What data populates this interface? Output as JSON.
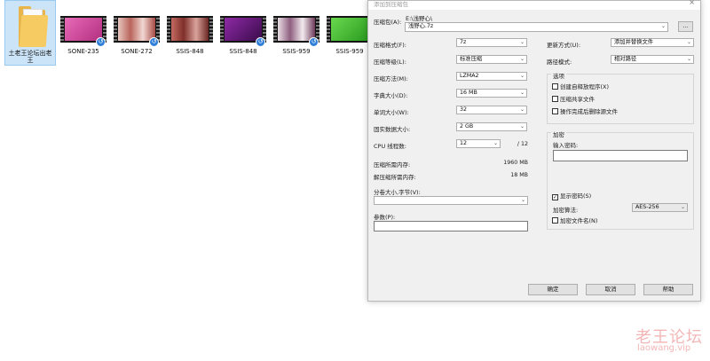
{
  "files": [
    {
      "name": "土老王论坛出老王",
      "kind": "folder",
      "selected": true
    },
    {
      "name": "SONE-235",
      "kind": "video",
      "accent": "#d84da6"
    },
    {
      "name": "SONE-272",
      "kind": "video",
      "accent": "#c98f8a"
    },
    {
      "name": "SSIS-848",
      "kind": "video",
      "accent": "#b25a5a"
    },
    {
      "name": "SSIS-848",
      "kind": "video",
      "accent": "#6b1f7e"
    },
    {
      "name": "SSIS-959",
      "kind": "video",
      "accent": "#9a6f8f"
    },
    {
      "name": "SSIS-959",
      "kind": "video",
      "accent": "#3bbf2e"
    }
  ],
  "dialog": {
    "title": "添加到压缩包",
    "close": "×",
    "archive_label": "压缩包(A):",
    "archive_path": "E:\\浅野心\\",
    "archive_name": "浅野心.7z",
    "browse_label": "...",
    "format_label": "压缩格式(F):",
    "format_value": "7z",
    "level_label": "压缩等级(L):",
    "level_value": "标准压缩",
    "method_label": "压缩方法(M):",
    "method_value": "LZMA2",
    "dict_label": "字典大小(D):",
    "dict_value": "16 MB",
    "word_label": "单词大小(W):",
    "word_value": "32",
    "solid_label": "固实数据大小:",
    "solid_value": "2 GB",
    "threads_label": "CPU 线程数:",
    "threads_value": "12",
    "threads_total": "/ 12",
    "mem_comp_label": "压缩所需内存:",
    "mem_comp_value": "1960 MB",
    "mem_decomp_label": "解压缩所需内存:",
    "mem_decomp_value": "18 MB",
    "volume_label": "分卷大小,字节(V):",
    "params_label": "参数(P):",
    "update_label": "更新方式(U):",
    "update_value": "添加并替换文件",
    "path_label": "路径模式:",
    "path_value": "相对路径",
    "options_title": "选项",
    "opt_sfx": "创建自释放程序(X)",
    "opt_shared": "压缩共享文件",
    "opt_delete": "操作完成后删除源文件",
    "enc_title": "加密",
    "enc_pwd_label": "输入密码:",
    "show_pwd": "显示密码(S)",
    "enc_method_label": "加密算法:",
    "enc_method_value": "AES-256",
    "enc_names": "加密文件名(N)",
    "btn_ok": "确定",
    "btn_cancel": "取消",
    "btn_help": "帮助",
    "check_mark": "✓",
    "arrow": "⌄"
  },
  "watermark": {
    "line1": "老王论坛",
    "line2": "laowang.vip"
  }
}
